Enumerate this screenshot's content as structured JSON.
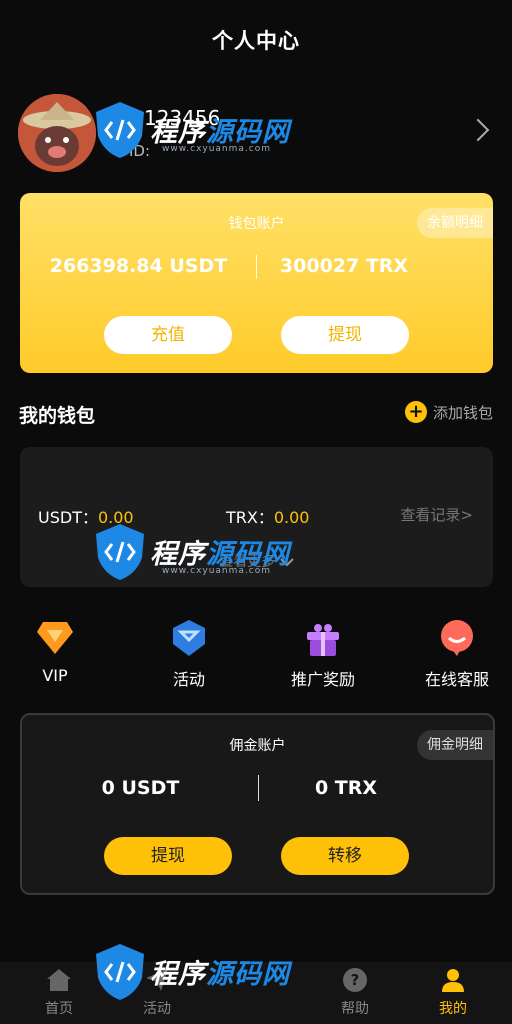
{
  "header": {
    "title": "个人中心"
  },
  "profile": {
    "username": "123456",
    "uid_label": "UID:"
  },
  "wallet_account": {
    "title": "钱包账户",
    "detail_label": "余额明细",
    "usdt_balance": "266398.84 USDT",
    "trx_balance": "300027 TRX",
    "recharge_label": "充值",
    "withdraw_label": "提现"
  },
  "my_wallet": {
    "title": "我的钱包",
    "add_label": "添加钱包",
    "usdt_label": "USDT：",
    "usdt_value": "0.00",
    "trx_label": "TRX：",
    "trx_value": "0.00",
    "records_label": "查看记录>",
    "more_label": "查看更多"
  },
  "shortcuts": [
    {
      "label": "VIP",
      "icon": "vip-diamond-icon"
    },
    {
      "label": "活动",
      "icon": "activity-badge-icon"
    },
    {
      "label": "推广奖励",
      "icon": "gift-box-icon"
    },
    {
      "label": "在线客服",
      "icon": "chat-bubble-icon"
    }
  ],
  "commission_account": {
    "title": "佣金账户",
    "detail_label": "佣金明细",
    "usdt_balance": "0 USDT",
    "trx_balance": "0 TRX",
    "withdraw_label": "提现",
    "transfer_label": "转移"
  },
  "watermark": {
    "text_a": "程序",
    "text_b": "源码网",
    "sub": "www.cxyuanma.com"
  },
  "tabbar": [
    {
      "label": "首页",
      "icon": "home-icon",
      "active": false
    },
    {
      "label": "活动",
      "icon": "send-icon",
      "active": false
    },
    {
      "label": "帮助",
      "icon": "help-icon",
      "active": false
    },
    {
      "label": "我的",
      "icon": "user-icon",
      "active": true
    }
  ],
  "colors": {
    "accent": "#ffc107",
    "background": "#0b0b0b",
    "card": "#1c1c1c"
  }
}
